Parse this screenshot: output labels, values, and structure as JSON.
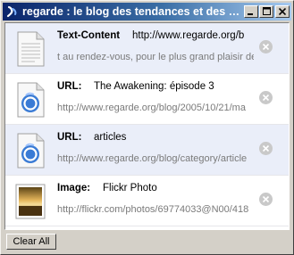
{
  "window": {
    "title": "regarde : le blog des tendances et des curi...",
    "controls": {
      "minimize_icon": "minimize-icon",
      "restore_icon": "restore-icon",
      "close_icon": "close-icon"
    }
  },
  "items": [
    {
      "type_label": "Text-Content",
      "title": "http://www.regarde.org/b",
      "url": "t au rendez-vous, pour le plus grand plaisir de",
      "icon": "text-document-icon"
    },
    {
      "type_label": "URL:",
      "title": "The Awakening: épisode 3",
      "url": "http://www.regarde.org/blog/2005/10/21/ma",
      "icon": "url-link-icon"
    },
    {
      "type_label": "URL:",
      "title": "articles",
      "url": "http://www.regarde.org/blog/category/article",
      "icon": "url-link-icon"
    },
    {
      "type_label": "Image:",
      "title": "Flickr Photo",
      "url": "http://flickr.com/photos/69774033@N00/418",
      "icon": "image-photo-icon"
    }
  ],
  "footer": {
    "clear_label": "Clear All"
  },
  "colors": {
    "title_gradient_start": "#0a246a",
    "title_gradient_end": "#a6caf0",
    "alt_row": "#eaeef9",
    "url_text": "#7a7a7a"
  }
}
